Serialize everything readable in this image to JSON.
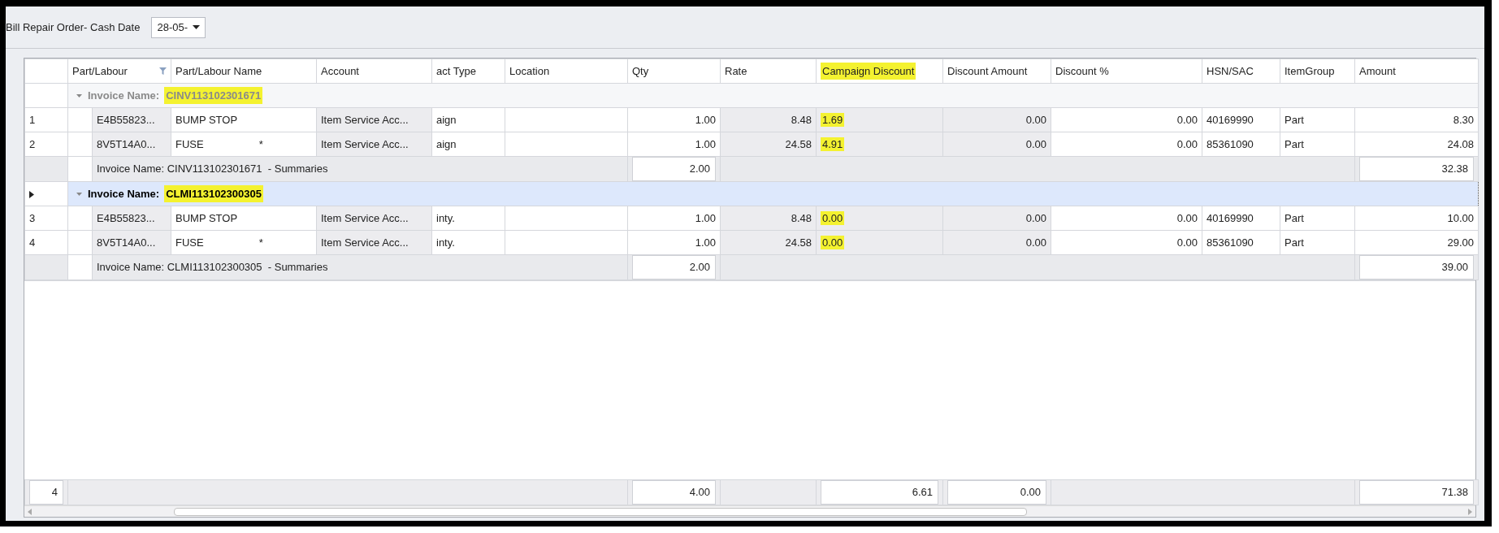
{
  "toolbar": {
    "label": "Bill Repair Order- Cash Date",
    "date_value": "28-05-"
  },
  "columns": [
    {
      "label": "Part/Labour",
      "filter": true,
      "highlighted": false
    },
    {
      "label": "Part/Labour Name",
      "filter": false,
      "highlighted": false
    },
    {
      "label": "Account",
      "filter": false,
      "highlighted": false
    },
    {
      "label": "act Type",
      "filter": false,
      "highlighted": false
    },
    {
      "label": "Location",
      "filter": false,
      "highlighted": false
    },
    {
      "label": "Qty",
      "filter": false,
      "highlighted": false
    },
    {
      "label": "Rate",
      "filter": false,
      "highlighted": false
    },
    {
      "label": "Campaign Discount",
      "filter": false,
      "highlighted": true
    },
    {
      "label": "Discount Amount",
      "filter": false,
      "highlighted": false
    },
    {
      "label": "Discount %",
      "filter": false,
      "highlighted": false
    },
    {
      "label": "HSN/SAC",
      "filter": false,
      "highlighted": false
    },
    {
      "label": "ItemGroup",
      "filter": false,
      "highlighted": false
    },
    {
      "label": "Amount",
      "filter": false,
      "highlighted": false
    }
  ],
  "groups": [
    {
      "label": "Invoice Name:",
      "name": "CINV113102301671",
      "name_highlighted": true,
      "expanded": true,
      "selected": false,
      "rows": [
        {
          "number": "1",
          "name_mark": null,
          "campaign_highlighted": true,
          "cells": [
            "E4B55823...",
            "BUMP STOP",
            "Item Service Acc...",
            "aign",
            null,
            "1.00",
            "8.48",
            "1.69",
            "0.00",
            "0.00",
            "40169990",
            "Part",
            "8.30"
          ]
        },
        {
          "number": "2",
          "name_mark": "*",
          "campaign_highlighted": true,
          "cells": [
            "8V5T14A0...",
            "FUSE",
            "Item Service Acc...",
            "aign",
            null,
            "1.00",
            "24.58",
            "4.91",
            "0.00",
            "0.00",
            "85361090",
            "Part",
            "24.08"
          ]
        }
      ],
      "summary": {
        "label": "Invoice Name: CINV113102301671  - Summaries",
        "qty": "2.00",
        "amount": "32.38"
      }
    },
    {
      "label": "Invoice Name:",
      "name": "CLMI113102300305",
      "name_highlighted": true,
      "expanded": true,
      "selected": true,
      "rows": [
        {
          "number": "3",
          "name_mark": null,
          "campaign_highlighted": true,
          "cells": [
            "E4B55823...",
            "BUMP STOP",
            "Item Service Acc...",
            "inty.",
            null,
            "1.00",
            "8.48",
            "0.00",
            "0.00",
            "0.00",
            "40169990",
            "Part",
            "10.00"
          ]
        },
        {
          "number": "4",
          "name_mark": "*",
          "campaign_highlighted": true,
          "cells": [
            "8V5T14A0...",
            "FUSE",
            "Item Service Acc...",
            "inty.",
            null,
            "1.00",
            "24.58",
            "0.00",
            "0.00",
            "0.00",
            "85361090",
            "Part",
            "29.00"
          ]
        }
      ],
      "summary": {
        "label": "Invoice Name: CLMI113102300305  - Summaries",
        "qty": "2.00",
        "amount": "39.00"
      }
    }
  ],
  "footer": {
    "count": "4",
    "qty": "4.00",
    "campaign_discount": "6.61",
    "discount_amount": "0.00",
    "amount": "71.38"
  }
}
